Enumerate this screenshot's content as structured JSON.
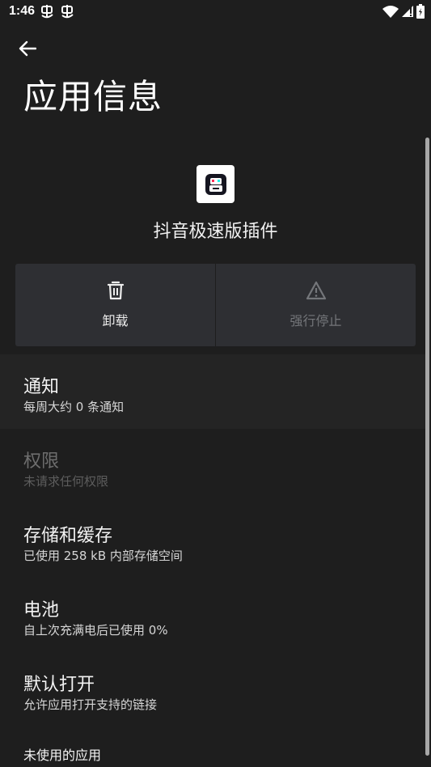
{
  "status_bar": {
    "time": "1:46",
    "notification_icons": [
      "app-notification-icon",
      "app-notification-icon"
    ],
    "right_icons": [
      "wifi-icon",
      "signal-icon",
      "battery-icon"
    ]
  },
  "header": {
    "back_icon": "arrow-left-icon",
    "title": "应用信息"
  },
  "app": {
    "name": "抖音极速版插件",
    "icon": "app-icon"
  },
  "actions": [
    {
      "label": "卸载",
      "icon": "trash-icon",
      "enabled": true
    },
    {
      "label": "强行停止",
      "icon": "warning-icon",
      "enabled": false
    }
  ],
  "settings": [
    {
      "title": "通知",
      "subtitle": "每周大约 0 条通知",
      "enabled": true
    },
    {
      "title": "权限",
      "subtitle": "未请求任何权限",
      "enabled": false
    },
    {
      "title": "存储和缓存",
      "subtitle": "已使用 258 kB 内部存储空间",
      "enabled": true
    },
    {
      "title": "电池",
      "subtitle": "自上次充满电后已使用 0%",
      "enabled": true
    },
    {
      "title": "默认打开",
      "subtitle": "允许应用打开支持的链接",
      "enabled": true
    },
    {
      "title": "未使用的应用",
      "subtitle": "",
      "enabled": true
    }
  ],
  "colors": {
    "background": "#1e1e1e",
    "button_bg": "#2e2f33",
    "text_primary": "#f1f1f1",
    "text_disabled": "#6e6e6e"
  }
}
